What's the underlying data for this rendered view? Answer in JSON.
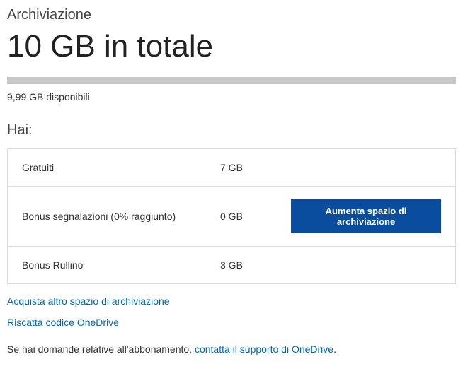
{
  "header": {
    "section_label": "Archiviazione",
    "total": "10 GB in totale",
    "available": "9,99 GB disponibili"
  },
  "have": {
    "label": "Hai:",
    "rows": [
      {
        "label": "Gratuiti",
        "value": "7 GB",
        "action": null
      },
      {
        "label": "Bonus segnalazioni (0% raggiunto)",
        "value": "0 GB",
        "action": "Aumenta spazio di archiviazione"
      },
      {
        "label": "Bonus Rullino",
        "value": "3 GB",
        "action": null
      }
    ]
  },
  "links": {
    "buy_more": "Acquista altro spazio di archiviazione",
    "redeem": "Riscatta codice OneDrive"
  },
  "footer": {
    "prefix": "Se hai domande relative all'abbonamento, ",
    "link": "contatta il supporto di OneDrive",
    "suffix": "."
  }
}
